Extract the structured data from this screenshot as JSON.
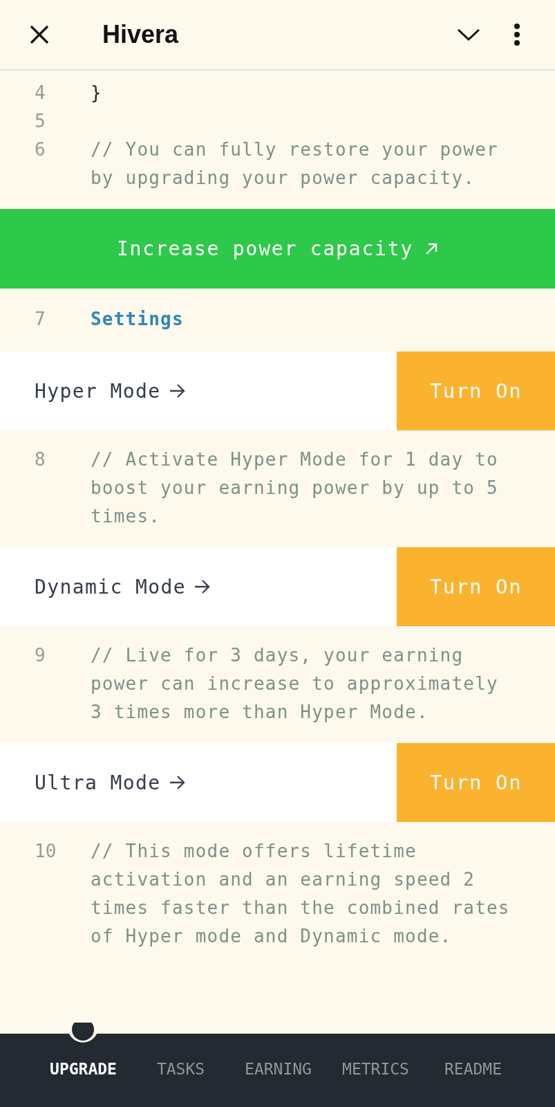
{
  "app_bar": {
    "title": "Hivera"
  },
  "editor": [
    {
      "kind": "code",
      "number": "4",
      "text": "}"
    },
    {
      "kind": "blank",
      "number": "5"
    },
    {
      "kind": "comment",
      "number": "6",
      "text": "// You can fully restore your power by upgrading your power capacity."
    },
    {
      "kind": "button",
      "label": "Increase power capacity"
    },
    {
      "kind": "link",
      "number": "7",
      "text": "Settings"
    },
    {
      "kind": "mode",
      "name": "Hyper Mode",
      "button": "Turn On"
    },
    {
      "kind": "comment",
      "number": "8",
      "text": "// Activate Hyper Mode for 1 day to boost your earning power by up to 5 times."
    },
    {
      "kind": "mode",
      "name": "Dynamic Mode",
      "button": "Turn On"
    },
    {
      "kind": "comment",
      "number": "9",
      "text": "// Live for 3 days, your earning power can increase to approximately 3 times more than Hyper Mode."
    },
    {
      "kind": "mode",
      "name": "Ultra Mode",
      "button": "Turn On"
    },
    {
      "kind": "comment",
      "number": "10",
      "text": "// This mode offers lifetime activation and an earning speed 2 times faster than the combined rates of Hyper mode and Dynamic mode."
    }
  ],
  "bottom_nav": [
    {
      "label": "UPGRADE",
      "selected": true
    },
    {
      "label": "TASKS",
      "selected": false
    },
    {
      "label": "EARNING",
      "selected": false
    },
    {
      "label": "METRICS",
      "selected": false
    },
    {
      "label": "README",
      "selected": false
    }
  ]
}
